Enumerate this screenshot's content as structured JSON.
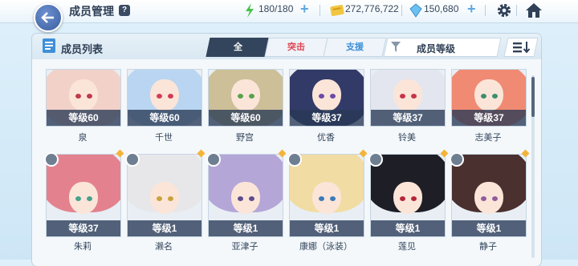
{
  "header": {
    "title": "成员管理",
    "help": "?",
    "stamina": "180/180",
    "gold": "272,776,722",
    "gems": "150,680"
  },
  "panel": {
    "title": "成员列表",
    "tabs": [
      "全",
      "突击",
      "支援"
    ],
    "sort_label": "成员等级"
  },
  "members": [
    {
      "name": "泉",
      "level": "等级60",
      "hair": "#f2d1c8",
      "eye": "#c0394a"
    },
    {
      "name": "千世",
      "level": "等级60",
      "hair": "#b9d5f1",
      "eye": "#d43b56"
    },
    {
      "name": "野宫",
      "level": "等级60",
      "hair": "#cdbf98",
      "eye": "#59a24c"
    },
    {
      "name": "优香",
      "level": "等级37",
      "hair": "#323a67",
      "eye": "#6c4aa6"
    },
    {
      "name": "铃美",
      "level": "等级37",
      "hair": "#e3e6ee",
      "eye": "#c6344a"
    },
    {
      "name": "志美子",
      "level": "等级37",
      "hair": "#f08a73",
      "eye": "#3c8f6f"
    },
    {
      "name": "朱莉",
      "level": "等级37",
      "hair": "#e3828e",
      "eye": "#46a28a"
    },
    {
      "name": "濑名",
      "level": "等级1",
      "hair": "#e7e7ea",
      "eye": "#c9a23a"
    },
    {
      "name": "亚津子",
      "level": "等级1",
      "hair": "#b5a6d8",
      "eye": "#5d4b8e"
    },
    {
      "name": "康娜（泳装）",
      "level": "等级1",
      "hair": "#f1dca3",
      "eye": "#3b7ab8"
    },
    {
      "name": "莲见",
      "level": "等级1",
      "hair": "#1e1e26",
      "eye": "#b3263a"
    },
    {
      "name": "静子",
      "level": "等级1",
      "hair": "#4a302f",
      "eye": "#8f5c9e"
    }
  ]
}
